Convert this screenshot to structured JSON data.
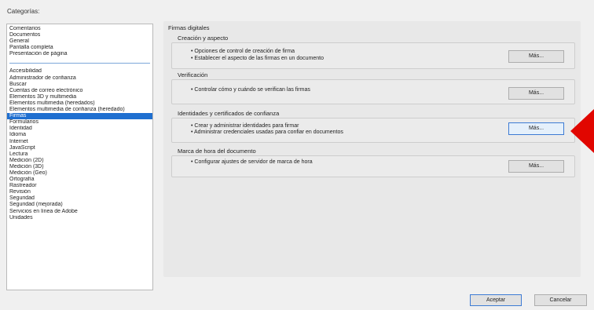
{
  "categories_label": "Categorías:",
  "categories_top": [
    "Comentarios",
    "Documentos",
    "General",
    "Pantalla completa",
    "Presentación de página"
  ],
  "categories_bottom": [
    "Accesibilidad",
    "Administrador de confianza",
    "Buscar",
    "Cuentas de correo electrónico",
    "Elementos 3D y multimedia",
    "Elementos multimedia (heredados)",
    "Elementos multimedia de confianza (heredado)",
    "Firmas",
    "Formularios",
    "Identidad",
    "Idioma",
    "Internet",
    "JavaScript",
    "Lectura",
    "Medición (2D)",
    "Medición (3D)",
    "Medición (Geo)",
    "Ortografía",
    "Rastreador",
    "Revisión",
    "Seguridad",
    "Seguridad (mejorada)",
    "Servicios en línea de Adobe",
    "Unidades"
  ],
  "selected_category": "Firmas",
  "panel": {
    "title": "Firmas digitales",
    "sections": [
      {
        "heading": "Creación y aspecto",
        "lines": [
          "• Opciones de control de creación de firma",
          "• Establecer el aspecto de las firmas en un documento"
        ],
        "button": "Más..."
      },
      {
        "heading": "Verificación",
        "lines": [
          "• Controlar cómo y cuándo se verifican las firmas"
        ],
        "button": "Más..."
      },
      {
        "heading": "Identidades y certificados de confianza",
        "lines": [
          "• Crear y administrar identidades para firmar",
          "• Administrar credenciales usadas para confiar en documentos"
        ],
        "button": "Más..."
      },
      {
        "heading": "Marca de hora del documento",
        "lines": [
          "• Configurar ajustes de servidor de marca de hora"
        ],
        "button": "Más..."
      }
    ]
  },
  "footer": {
    "accept": "Aceptar",
    "cancel": "Cancelar"
  },
  "colors": {
    "selection": "#1f6fd0",
    "annotation_arrow": "#e10600",
    "focus_border": "#3d7bd4"
  },
  "annotation": {
    "icon": "red-pointer-arrow",
    "points_to": "Identidades y certificados de confianza > Más..."
  }
}
